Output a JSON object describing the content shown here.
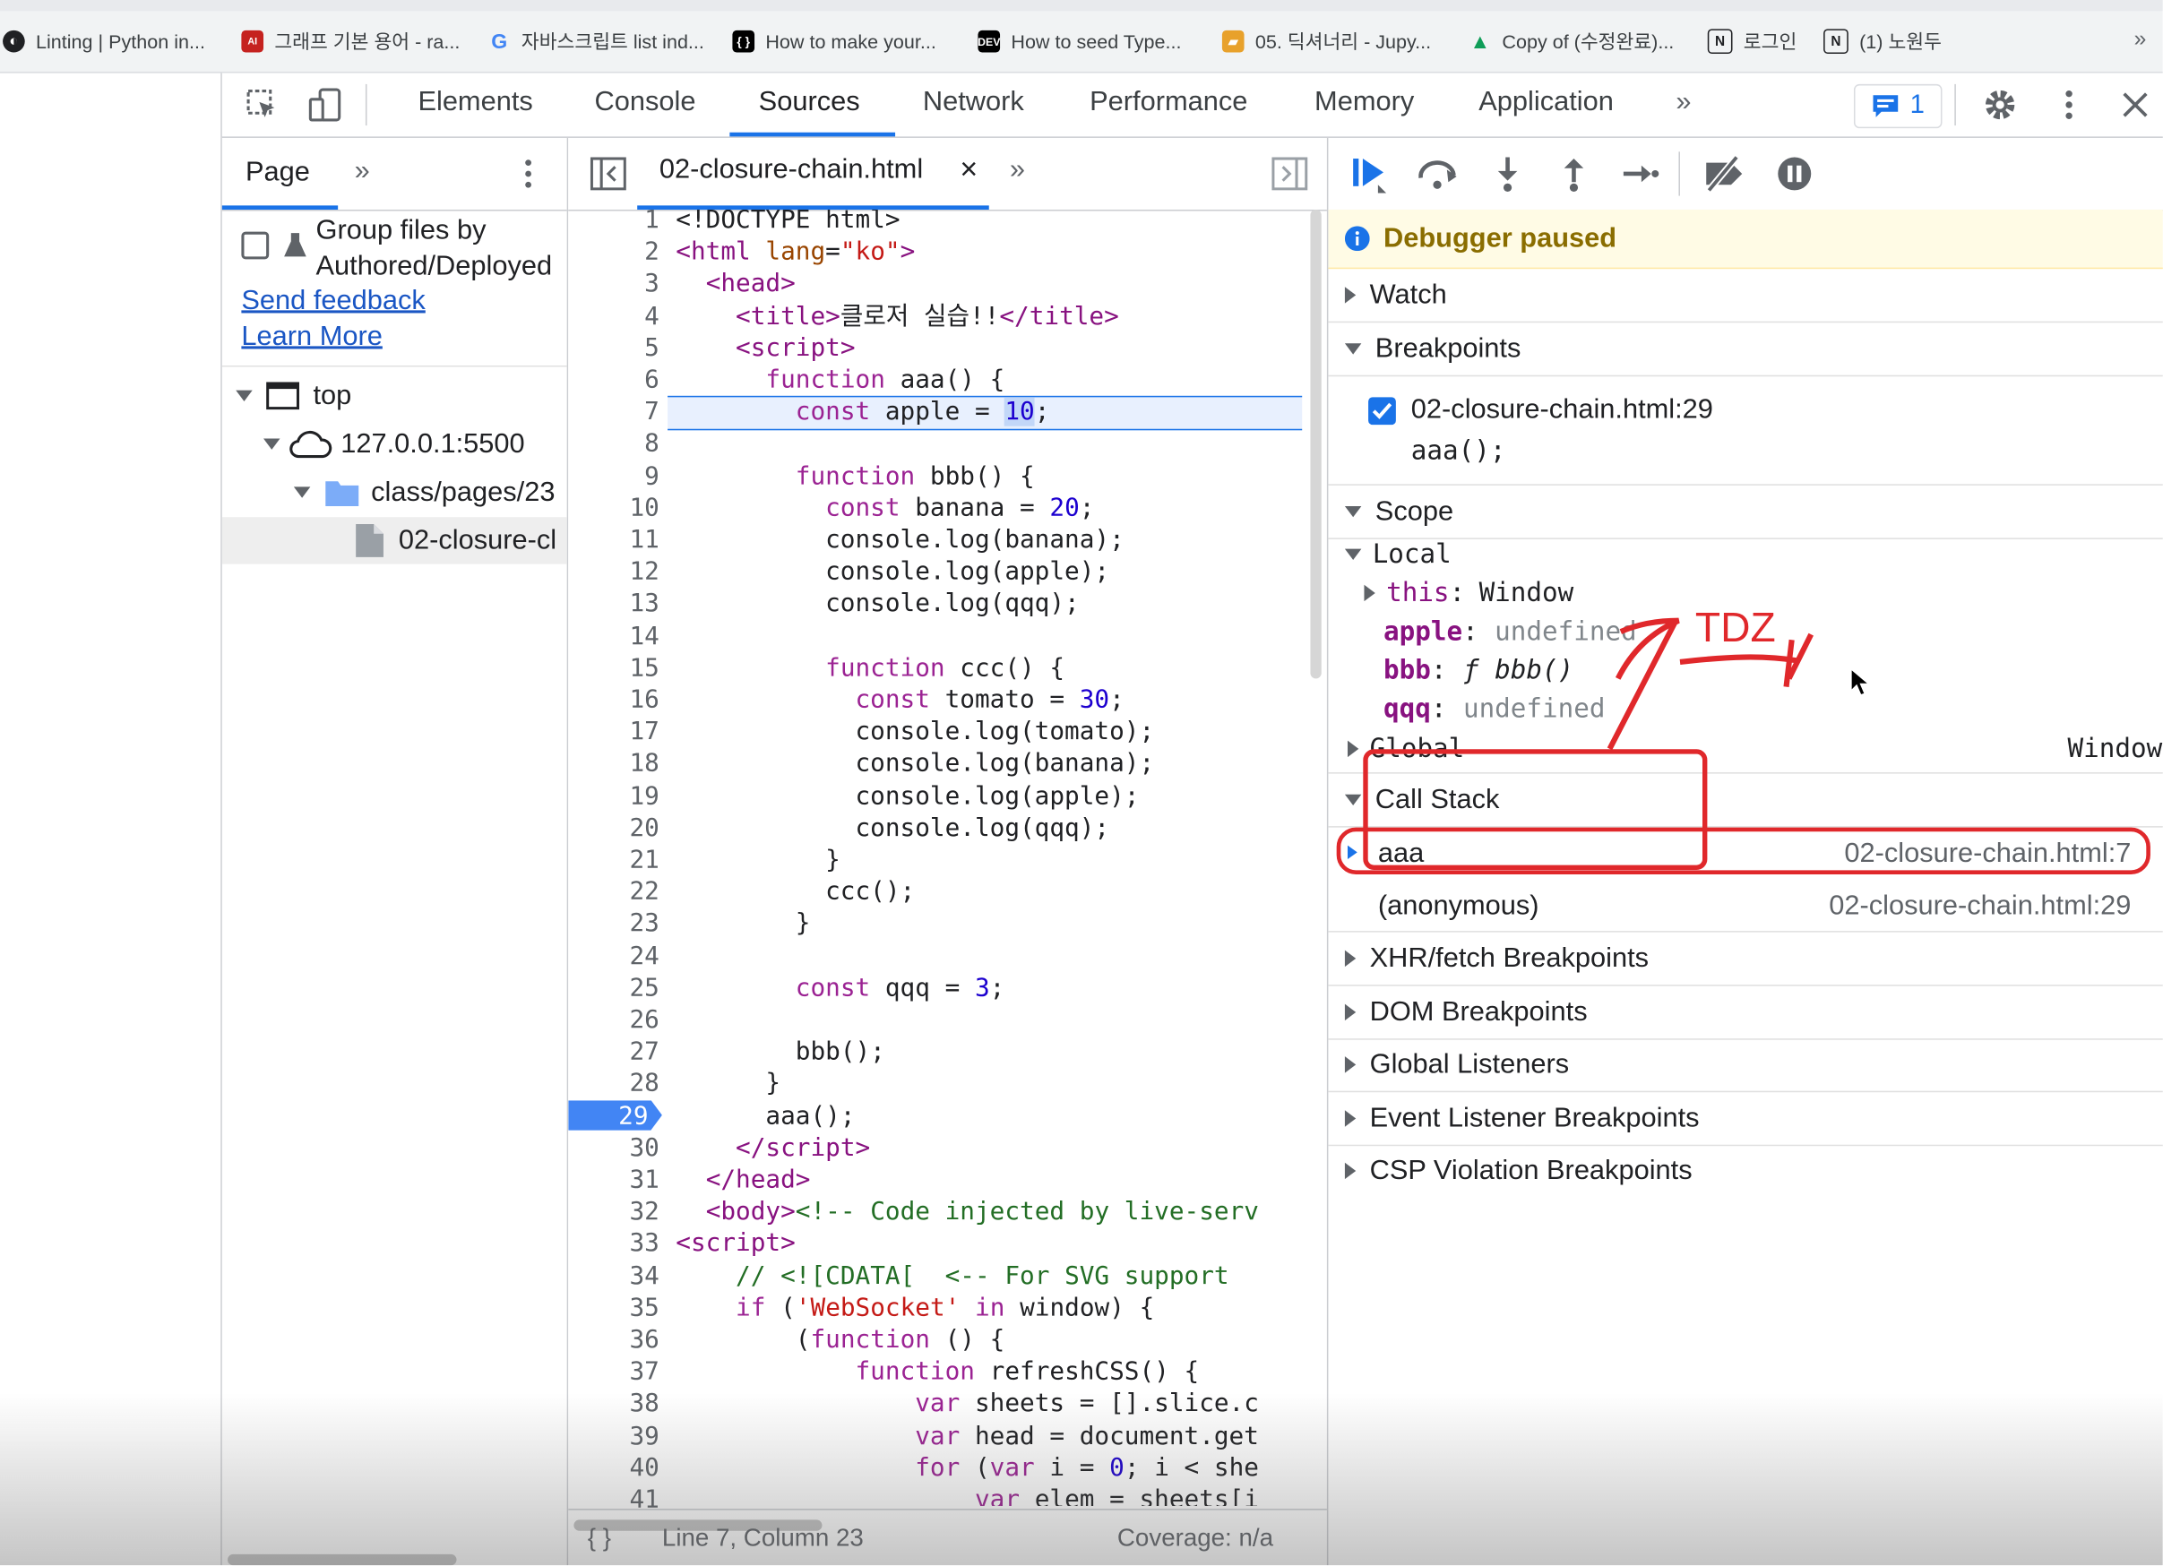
{
  "bookmarks": [
    {
      "label": "Linting | Python in...",
      "icon": "vscode-icon"
    },
    {
      "label": "그래프 기본 용어 - ra...",
      "icon": "blog-icon"
    },
    {
      "label": "자바스크립트 list ind...",
      "icon": "google-icon"
    },
    {
      "label": "How to make your...",
      "icon": "dev-icon"
    },
    {
      "label": "How to seed Type...",
      "icon": "dev-icon"
    },
    {
      "label": "05. 딕셔너리 - Jupy...",
      "icon": "wikidocs-icon"
    },
    {
      "label": "Copy of (수정완료)...",
      "icon": "drive-icon"
    },
    {
      "label": "로그인",
      "icon": "notion-icon"
    },
    {
      "label": "(1) 노원두",
      "icon": "notion-icon"
    }
  ],
  "bookmarks_more": "»",
  "toolbar": {
    "tabs": [
      "Elements",
      "Console",
      "Sources",
      "Network",
      "Performance",
      "Memory",
      "Application"
    ],
    "active_tab": "Sources",
    "more": "»",
    "issues_count": "1"
  },
  "left_panel": {
    "tab": "Page",
    "more": "»",
    "group_label_1": "Group files by",
    "group_label_2": "Authored/Deployed",
    "send_feedback": "Send feedback",
    "learn_more": "Learn More",
    "tree": {
      "top": "top",
      "host": "127.0.0.1:5500",
      "folder": "class/pages/23",
      "file": "02-closure-cl"
    }
  },
  "editor": {
    "file_tab": "02-closure-chain.html",
    "close": "×",
    "more": "»",
    "breakpoint_line": "29",
    "highlight_line": "7",
    "status_left": "{ }",
    "status_position": "Line 7, Column 23",
    "status_coverage": "Coverage: n/a",
    "lines": [
      {
        "n": "1",
        "html": "&lt;!DOCTYPE html&gt;"
      },
      {
        "n": "2",
        "html": "<span class='tag'>&lt;html</span> <span class='attr'>lang</span>=<span class='str'>\"ko\"</span><span class='tag'>&gt;</span>"
      },
      {
        "n": "3",
        "html": "  <span class='tag'>&lt;head&gt;</span>"
      },
      {
        "n": "4",
        "html": "    <span class='tag'>&lt;title&gt;</span>클로저 실습!!<span class='tag'>&lt;/title&gt;</span>"
      },
      {
        "n": "5",
        "html": "    <span class='tag'>&lt;script&gt;</span>"
      },
      {
        "n": "6",
        "html": "      <span class='kw'>function</span> aaa() {"
      },
      {
        "n": "7",
        "html": "        <span class='kw'>const</span> apple = <span class='num' style='background:#c2d7f8'>10</span>;"
      },
      {
        "n": "8",
        "html": ""
      },
      {
        "n": "9",
        "html": "        <span class='kw'>function</span> bbb() {"
      },
      {
        "n": "10",
        "html": "          <span class='kw'>const</span> banana = <span class='num'>20</span>;"
      },
      {
        "n": "11",
        "html": "          console.log(banana);"
      },
      {
        "n": "12",
        "html": "          console.log(apple);"
      },
      {
        "n": "13",
        "html": "          console.log(qqq);"
      },
      {
        "n": "14",
        "html": ""
      },
      {
        "n": "15",
        "html": "          <span class='kw'>function</span> ccc() {"
      },
      {
        "n": "16",
        "html": "            <span class='kw'>const</span> tomato = <span class='num'>30</span>;"
      },
      {
        "n": "17",
        "html": "            console.log(tomato);"
      },
      {
        "n": "18",
        "html": "            console.log(banana);"
      },
      {
        "n": "19",
        "html": "            console.log(apple);"
      },
      {
        "n": "20",
        "html": "            console.log(qqq);"
      },
      {
        "n": "21",
        "html": "          }"
      },
      {
        "n": "22",
        "html": "          ccc();"
      },
      {
        "n": "23",
        "html": "        }"
      },
      {
        "n": "24",
        "html": ""
      },
      {
        "n": "25",
        "html": "        <span class='kw'>const</span> qqq = <span class='num'>3</span>;"
      },
      {
        "n": "26",
        "html": ""
      },
      {
        "n": "27",
        "html": "        bbb();"
      },
      {
        "n": "28",
        "html": "      }"
      },
      {
        "n": "29",
        "html": "      aaa();"
      },
      {
        "n": "30",
        "html": "    <span class='tag'>&lt;/script&gt;</span>"
      },
      {
        "n": "31",
        "html": "  <span class='tag'>&lt;/head&gt;</span>"
      },
      {
        "n": "32",
        "html": "  <span class='tag'>&lt;body&gt;</span><span class='cmt'>&lt;!-- Code injected by live-serv</span>"
      },
      {
        "n": "33",
        "html": "<span class='tag'>&lt;script&gt;</span>"
      },
      {
        "n": "34",
        "html": "    <span class='cmt'>// &lt;![CDATA[  &lt;-- For SVG support</span>"
      },
      {
        "n": "35",
        "html": "    <span class='kw'>if</span> (<span class='str'>'WebSocket'</span> <span class='kw'>in</span> window) {"
      },
      {
        "n": "36",
        "html": "        (<span class='kw'>function</span> () {"
      },
      {
        "n": "37",
        "html": "            <span class='kw'>function</span> refreshCSS() {"
      },
      {
        "n": "38",
        "html": "                <span class='kw'>var</span> sheets = [].slice.c"
      },
      {
        "n": "39",
        "html": "                <span class='kw'>var</span> head = document.get"
      },
      {
        "n": "40",
        "html": "                <span class='kw'>for</span> (<span class='kw'>var</span> i = <span class='num'>0</span>; i &lt; she"
      },
      {
        "n": "41",
        "html": "                    <span class='kw'>var</span> elem = sheets[i"
      }
    ]
  },
  "debugger": {
    "paused": "Debugger paused",
    "watch": "Watch",
    "breakpoints": "Breakpoints",
    "bp_file": "02-closure-chain.html:29",
    "bp_code": "aaa();",
    "scope": "Scope",
    "local": "Local",
    "this_key": "this",
    "this_val": "Window",
    "vars": [
      {
        "key": "apple",
        "val": "undefined"
      },
      {
        "key": "bbb",
        "val": "ƒ bbb()"
      },
      {
        "key": "qqq",
        "val": "undefined"
      }
    ],
    "global": "Global",
    "global_val": "Window",
    "call_stack": "Call Stack",
    "frames": [
      {
        "name": "aaa",
        "loc": "02-closure-chain.html:7"
      },
      {
        "name": "(anonymous)",
        "loc": "02-closure-chain.html:29"
      }
    ],
    "sections": [
      "XHR/fetch Breakpoints",
      "DOM Breakpoints",
      "Global Listeners",
      "Event Listener Breakpoints",
      "CSP Violation Breakpoints"
    ],
    "annotation": "TDZ"
  },
  "colors": {
    "accent": "#1a73e8",
    "annotation": "#e0282b",
    "paused_bg": "#fffbe5"
  }
}
